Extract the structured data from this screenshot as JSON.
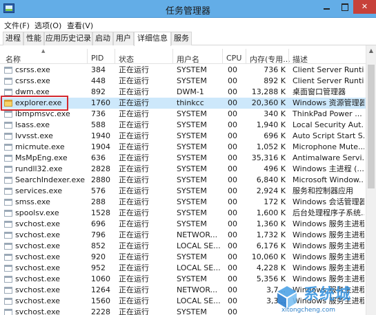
{
  "window": {
    "title": "任务管理器"
  },
  "menu": [
    "文件(F)",
    "选项(O)",
    "查看(V)"
  ],
  "tabs": [
    {
      "label": "进程",
      "active": false
    },
    {
      "label": "性能",
      "active": false
    },
    {
      "label": "应用历史记录",
      "active": false
    },
    {
      "label": "启动",
      "active": false
    },
    {
      "label": "用户",
      "active": false
    },
    {
      "label": "详细信息",
      "active": true
    },
    {
      "label": "服务",
      "active": false
    }
  ],
  "columns": {
    "name": "名称",
    "pid": "PID",
    "status": "状态",
    "user": "用户名",
    "cpu": "CPU",
    "memory": "内存(专用...",
    "description": "描述"
  },
  "rows": [
    {
      "name": "csrss.exe",
      "pid": "384",
      "status": "正在运行",
      "user": "SYSTEM",
      "cpu": "00",
      "memory": "736 K",
      "description": "Client Server Runti...",
      "icon": "generic"
    },
    {
      "name": "csrss.exe",
      "pid": "448",
      "status": "正在运行",
      "user": "SYSTEM",
      "cpu": "00",
      "memory": "892 K",
      "description": "Client Server Runti...",
      "icon": "generic"
    },
    {
      "name": "dwm.exe",
      "pid": "892",
      "status": "正在运行",
      "user": "DWM-1",
      "cpu": "00",
      "memory": "13,288 K",
      "description": "桌面窗口管理器",
      "icon": "generic"
    },
    {
      "name": "explorer.exe",
      "pid": "1760",
      "status": "正在运行",
      "user": "thinkcc",
      "cpu": "00",
      "memory": "20,360 K",
      "description": "Windows 资源管理器",
      "icon": "folder",
      "selected": true
    },
    {
      "name": "ibmpmsvc.exe",
      "pid": "736",
      "status": "正在运行",
      "user": "SYSTEM",
      "cpu": "00",
      "memory": "340 K",
      "description": "ThinkPad Power ...",
      "icon": "generic"
    },
    {
      "name": "lsass.exe",
      "pid": "588",
      "status": "正在运行",
      "user": "SYSTEM",
      "cpu": "00",
      "memory": "1,940 K",
      "description": "Local Security Aut...",
      "icon": "generic"
    },
    {
      "name": "lvvsst.exe",
      "pid": "1940",
      "status": "正在运行",
      "user": "SYSTEM",
      "cpu": "00",
      "memory": "696 K",
      "description": "Auto Script Start S...",
      "icon": "generic"
    },
    {
      "name": "micmute.exe",
      "pid": "1904",
      "status": "正在运行",
      "user": "SYSTEM",
      "cpu": "00",
      "memory": "1,052 K",
      "description": "Microphone Mute...",
      "icon": "generic"
    },
    {
      "name": "MsMpEng.exe",
      "pid": "636",
      "status": "正在运行",
      "user": "SYSTEM",
      "cpu": "00",
      "memory": "35,316 K",
      "description": "Antimalware Servi...",
      "icon": "generic"
    },
    {
      "name": "rundll32.exe",
      "pid": "2828",
      "status": "正在运行",
      "user": "SYSTEM",
      "cpu": "00",
      "memory": "496 K",
      "description": "Windows 主进程 (...",
      "icon": "generic"
    },
    {
      "name": "SearchIndexer.exe",
      "pid": "2880",
      "status": "正在运行",
      "user": "SYSTEM",
      "cpu": "00",
      "memory": "6,840 K",
      "description": "Microsoft Window...",
      "icon": "generic"
    },
    {
      "name": "services.exe",
      "pid": "576",
      "status": "正在运行",
      "user": "SYSTEM",
      "cpu": "00",
      "memory": "2,924 K",
      "description": "服务和控制器应用",
      "icon": "generic"
    },
    {
      "name": "smss.exe",
      "pid": "288",
      "status": "正在运行",
      "user": "SYSTEM",
      "cpu": "00",
      "memory": "172 K",
      "description": "Windows 会话管理器",
      "icon": "generic"
    },
    {
      "name": "spoolsv.exe",
      "pid": "1528",
      "status": "正在运行",
      "user": "SYSTEM",
      "cpu": "00",
      "memory": "1,600 K",
      "description": "后台处理程序子系统...",
      "icon": "generic"
    },
    {
      "name": "svchost.exe",
      "pid": "696",
      "status": "正在运行",
      "user": "SYSTEM",
      "cpu": "00",
      "memory": "1,360 K",
      "description": "Windows 服务主进程",
      "icon": "generic"
    },
    {
      "name": "svchost.exe",
      "pid": "796",
      "status": "正在运行",
      "user": "NETWOR...",
      "cpu": "00",
      "memory": "1,732 K",
      "description": "Windows 服务主进程",
      "icon": "generic"
    },
    {
      "name": "svchost.exe",
      "pid": "852",
      "status": "正在运行",
      "user": "LOCAL SE...",
      "cpu": "00",
      "memory": "6,176 K",
      "description": "Windows 服务主进程",
      "icon": "generic"
    },
    {
      "name": "svchost.exe",
      "pid": "920",
      "status": "正在运行",
      "user": "SYSTEM",
      "cpu": "00",
      "memory": "10,060 K",
      "description": "Windows 服务主进程",
      "icon": "generic"
    },
    {
      "name": "svchost.exe",
      "pid": "952",
      "status": "正在运行",
      "user": "LOCAL SE...",
      "cpu": "00",
      "memory": "4,228 K",
      "description": "Windows 服务主进程",
      "icon": "generic"
    },
    {
      "name": "svchost.exe",
      "pid": "1060",
      "status": "正在运行",
      "user": "SYSTEM",
      "cpu": "00",
      "memory": "5,356 K",
      "description": "Windows 服务主进程",
      "icon": "generic"
    },
    {
      "name": "svchost.exe",
      "pid": "1264",
      "status": "正在运行",
      "user": "NETWOR...",
      "cpu": "00",
      "memory": "3,7...",
      "description": "Windows 服务主进程",
      "icon": "generic"
    },
    {
      "name": "svchost.exe",
      "pid": "1560",
      "status": "正在运行",
      "user": "LOCAL SE...",
      "cpu": "00",
      "memory": "3,3...",
      "description": "Windows 服务主进程",
      "icon": "generic"
    },
    {
      "name": "svchost.exe",
      "pid": "2228",
      "status": "正在运行",
      "user": "SYSTEM",
      "cpu": "00",
      "memory": "",
      "description": "",
      "icon": "generic"
    }
  ],
  "watermark": {
    "text": "系统城",
    "url": "xitongcheng.com"
  },
  "colors": {
    "titlebar": "#63ade7",
    "close": "#c7413a",
    "selected_row": "#cde8fb",
    "highlight_box": "#d3272d"
  }
}
